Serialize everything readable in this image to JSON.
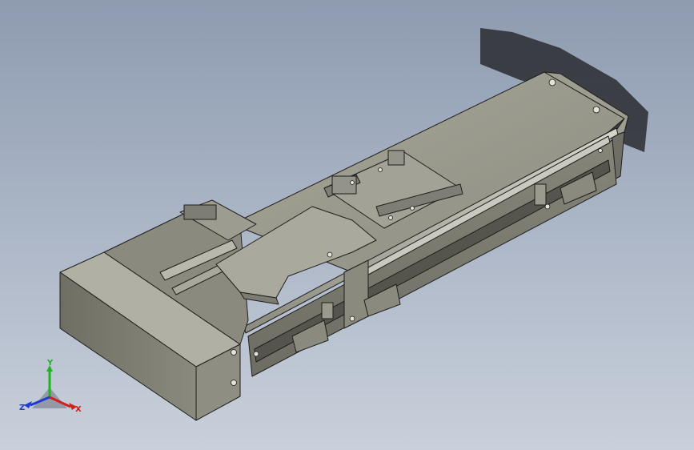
{
  "viewport": {
    "background_top": "#8e9bb0",
    "background_bottom": "#c9d0db",
    "model_color": "#8f8f84",
    "edge_color": "#1e1e1c"
  },
  "triad": {
    "x_label": "X",
    "y_label": "Y",
    "z_label": "Z",
    "x_color": "#d21e1e",
    "y_color": "#1eb41e",
    "z_color": "#1e3cd2"
  }
}
